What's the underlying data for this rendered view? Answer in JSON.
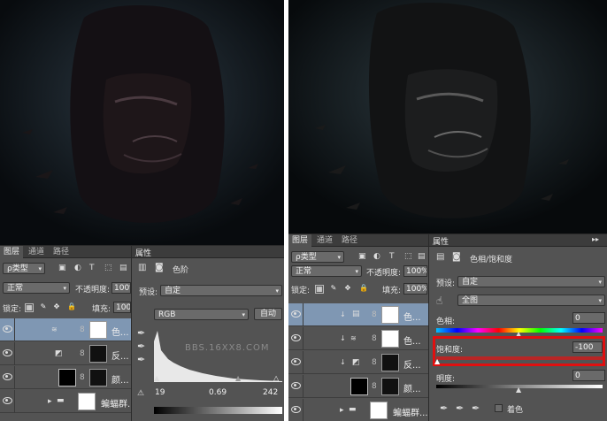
{
  "left": {
    "layers_panel": {
      "tabs": [
        "图层",
        "通道",
        "路径"
      ],
      "kind_filter": "ρ类型",
      "blend_mode": "正常",
      "opacity_label": "不透明度:",
      "opacity_value": "100%",
      "lock_label": "锁定:",
      "fill_label": "填充:",
      "fill_value": "100%",
      "layers": [
        {
          "name": "色...",
          "selected": true,
          "kind": "curves"
        },
        {
          "name": "反...",
          "selected": false,
          "kind": "invert"
        },
        {
          "name": "颜...",
          "selected": false,
          "kind": "color"
        },
        {
          "name": "蝙蝠群...",
          "selected": false,
          "kind": "group"
        }
      ]
    },
    "properties_panel": {
      "title": "属性",
      "adjustment_name": "色阶",
      "preset_label": "预设:",
      "preset_value": "自定",
      "channel_value": "RGB",
      "auto_button": "自动",
      "input_black": "19",
      "input_gamma": "0.69",
      "input_white": "242",
      "watermark": "BBS.16XX8.COM"
    }
  },
  "right": {
    "layers_panel": {
      "tabs": [
        "图层",
        "通道",
        "路径"
      ],
      "kind_filter": "ρ类型",
      "blend_mode": "正常",
      "opacity_label": "不透明度:",
      "opacity_value": "100%",
      "lock_label": "锁定:",
      "fill_label": "填充:",
      "fill_value": "100%",
      "layers": [
        {
          "name": "色...",
          "selected": true,
          "kind": "huesat"
        },
        {
          "name": "色...",
          "selected": false,
          "kind": "curves"
        },
        {
          "name": "反...",
          "selected": false,
          "kind": "invert"
        },
        {
          "name": "颜...",
          "selected": false,
          "kind": "color"
        },
        {
          "name": "蝙蝠群...",
          "selected": false,
          "kind": "group"
        }
      ]
    },
    "properties_panel": {
      "title": "属性",
      "adjustment_name": "色相/饱和度",
      "preset_label": "预设:",
      "preset_value": "自定",
      "range_value": "全图",
      "hue_label": "色相:",
      "hue_value": "0",
      "saturation_label": "饱和度:",
      "saturation_value": "-100",
      "lightness_label": "明度:",
      "lightness_value": "0",
      "colorize_label": "着色",
      "highlight_color": "#e01010"
    }
  }
}
